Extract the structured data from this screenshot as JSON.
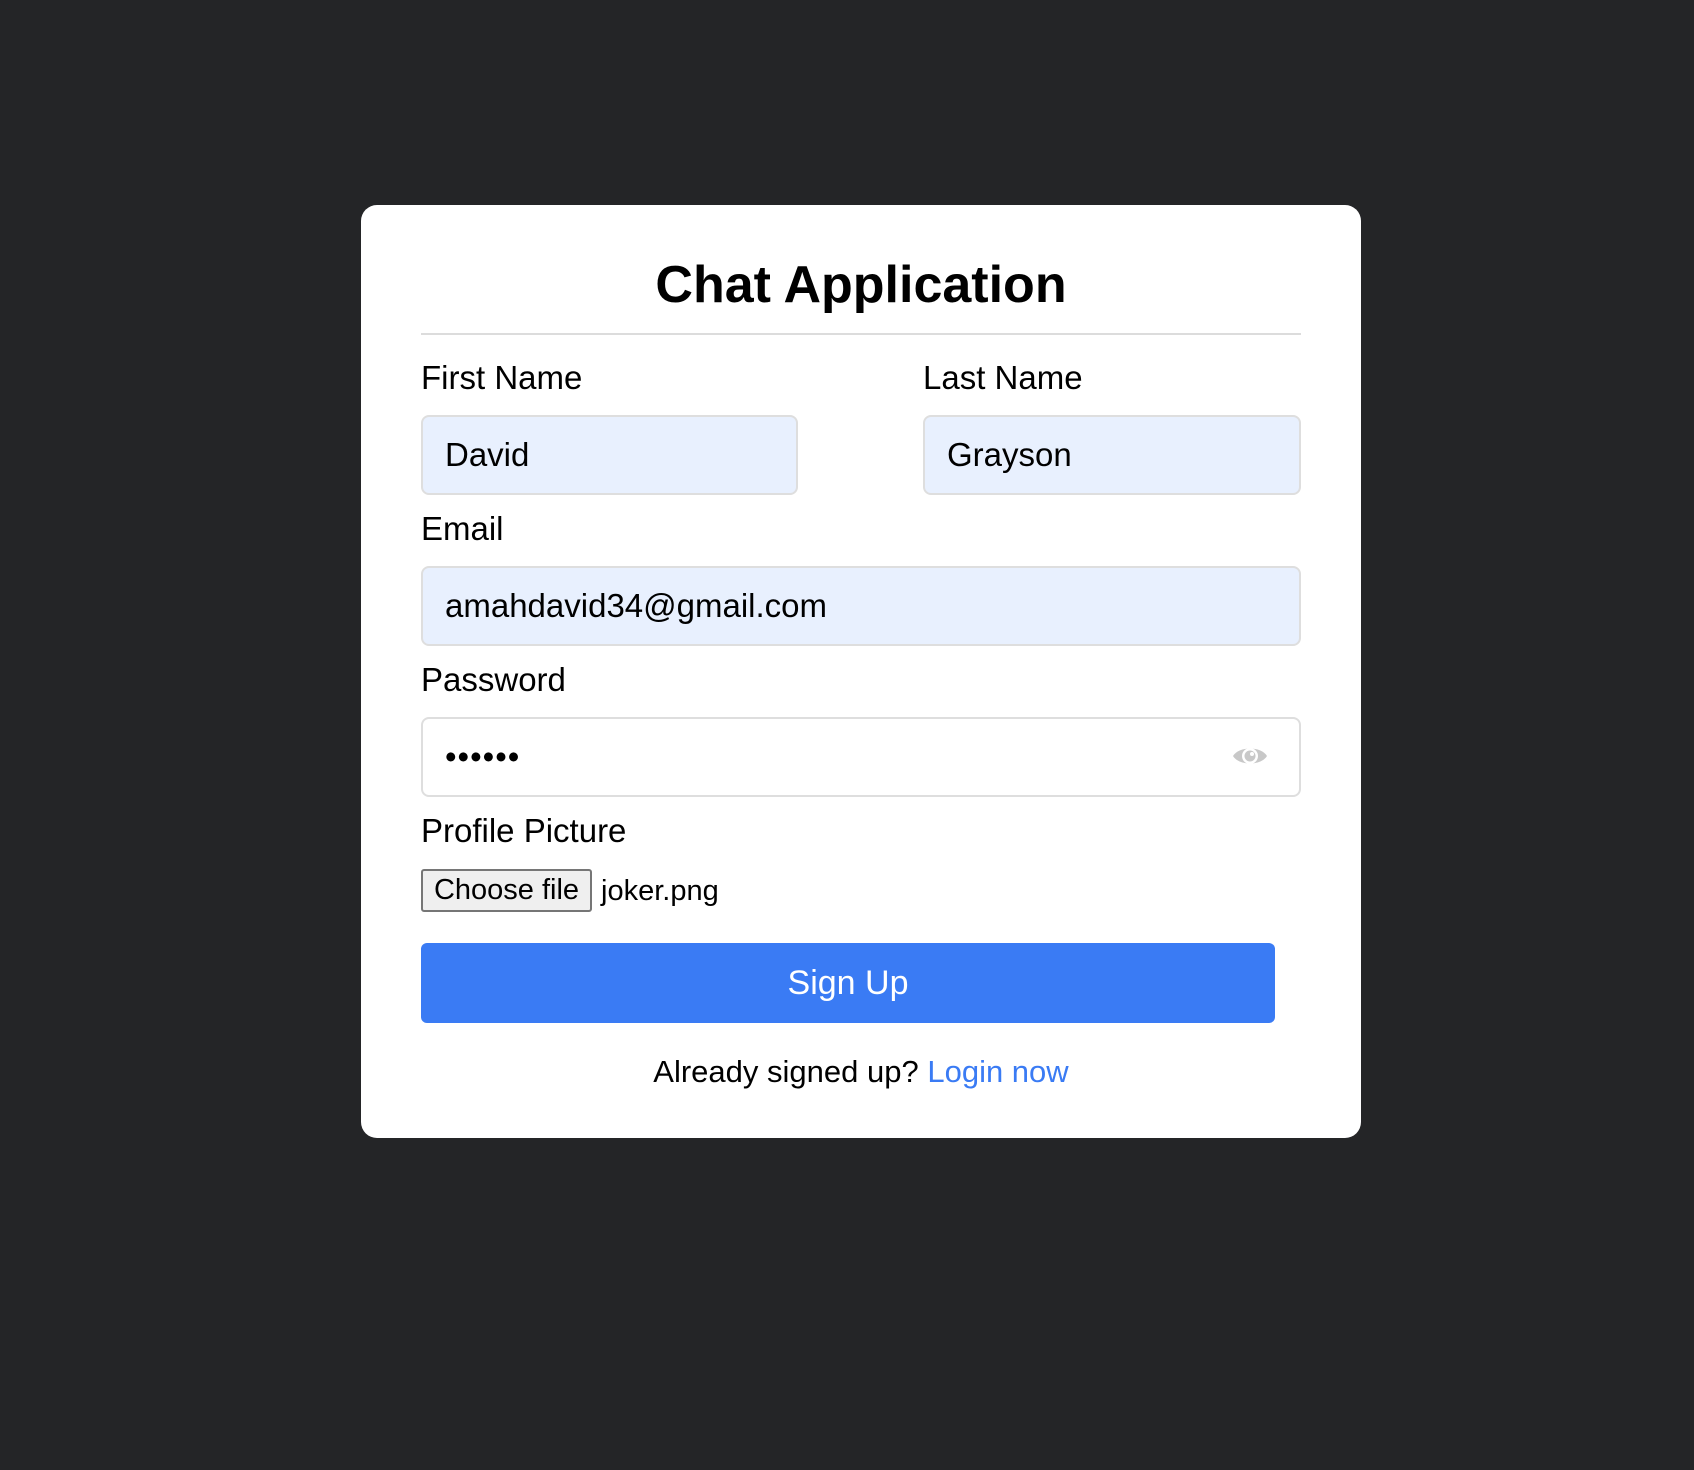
{
  "app_title": "Chat Application",
  "form": {
    "first_name": {
      "label": "First Name",
      "value": "David"
    },
    "last_name": {
      "label": "Last Name",
      "value": "Grayson"
    },
    "email": {
      "label": "Email",
      "value": "amahdavid34@gmail.com"
    },
    "password": {
      "label": "Password",
      "value": "••••••",
      "toggle_icon": "eye-icon"
    },
    "profile_picture": {
      "label": "Profile Picture",
      "button_label": "Choose file",
      "file_name": "joker.png"
    },
    "submit_label": "Sign Up"
  },
  "footer": {
    "prompt": "Already signed up?",
    "link_label": "Login now"
  },
  "colors": {
    "background": "#242527",
    "card": "#ffffff",
    "accent": "#3a7bf4",
    "autofill_field": "#e8f0fe"
  }
}
